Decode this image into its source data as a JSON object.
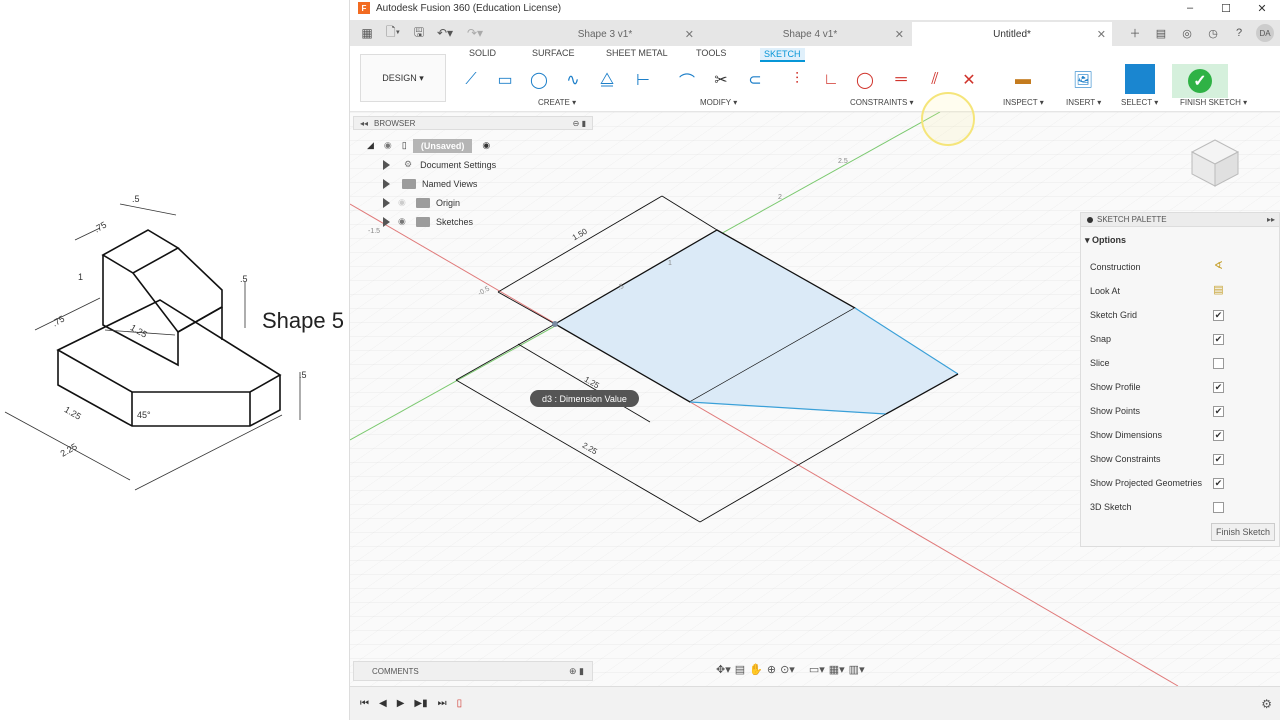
{
  "reference": {
    "label": "Shape 5",
    "dims": [
      ".5",
      ".75",
      "1",
      ".5",
      ".75",
      "1.25",
      ".5",
      "1.25",
      "45°",
      "2.25"
    ]
  },
  "window": {
    "title": "Autodesk Fusion 360 (Education License)",
    "logo": "F"
  },
  "tabs": [
    {
      "label": "Shape 3 v1*"
    },
    {
      "label": "Shape 4 v1*"
    },
    {
      "label": "Untitled*"
    }
  ],
  "user_initials": "DA",
  "toolbar": {
    "workspace": "DESIGN ▾",
    "ribbon_tabs": [
      "SOLID",
      "SURFACE",
      "SHEET METAL",
      "TOOLS",
      "SKETCH"
    ],
    "groups": {
      "create": "CREATE ▾",
      "modify": "MODIFY ▾",
      "constraints": "CONSTRAINTS ▾",
      "inspect": "INSPECT ▾",
      "insert": "INSERT ▾",
      "select": "SELECT ▾",
      "finish": "FINISH SKETCH ▾"
    }
  },
  "browser": {
    "title": "BROWSER",
    "root": "(Unsaved)",
    "items": [
      "Document Settings",
      "Named Views",
      "Origin",
      "Sketches"
    ]
  },
  "palette": {
    "title": "SKETCH PALETTE",
    "section": "Options",
    "rows": [
      {
        "label": "Construction",
        "control": "icon",
        "glyph": "∢"
      },
      {
        "label": "Look At",
        "control": "icon",
        "glyph": "▤"
      },
      {
        "label": "Sketch Grid",
        "control": "checkbox",
        "checked": true
      },
      {
        "label": "Snap",
        "control": "checkbox",
        "checked": true
      },
      {
        "label": "Slice",
        "control": "checkbox",
        "checked": false
      },
      {
        "label": "Show Profile",
        "control": "checkbox",
        "checked": true
      },
      {
        "label": "Show Points",
        "control": "checkbox",
        "checked": true
      },
      {
        "label": "Show Dimensions",
        "control": "checkbox",
        "checked": true
      },
      {
        "label": "Show Constraints",
        "control": "checkbox",
        "checked": true
      },
      {
        "label": "Show Projected Geometries",
        "control": "checkbox",
        "checked": true
      },
      {
        "label": "3D Sketch",
        "control": "checkbox",
        "checked": false
      }
    ],
    "finish_button": "Finish Sketch"
  },
  "canvas": {
    "tooltip": "d3 : Dimension Value",
    "dim_labels": [
      "1.50",
      "1.25",
      "2.25",
      ".5",
      "-0.5",
      "2",
      "2.5",
      "1",
      "-1.5"
    ]
  },
  "comments": {
    "title": "COMMENTS"
  },
  "colors": {
    "accent": "#0696d7",
    "finish_green": "#2fb245",
    "profile_fill": "#dbeaf7"
  }
}
